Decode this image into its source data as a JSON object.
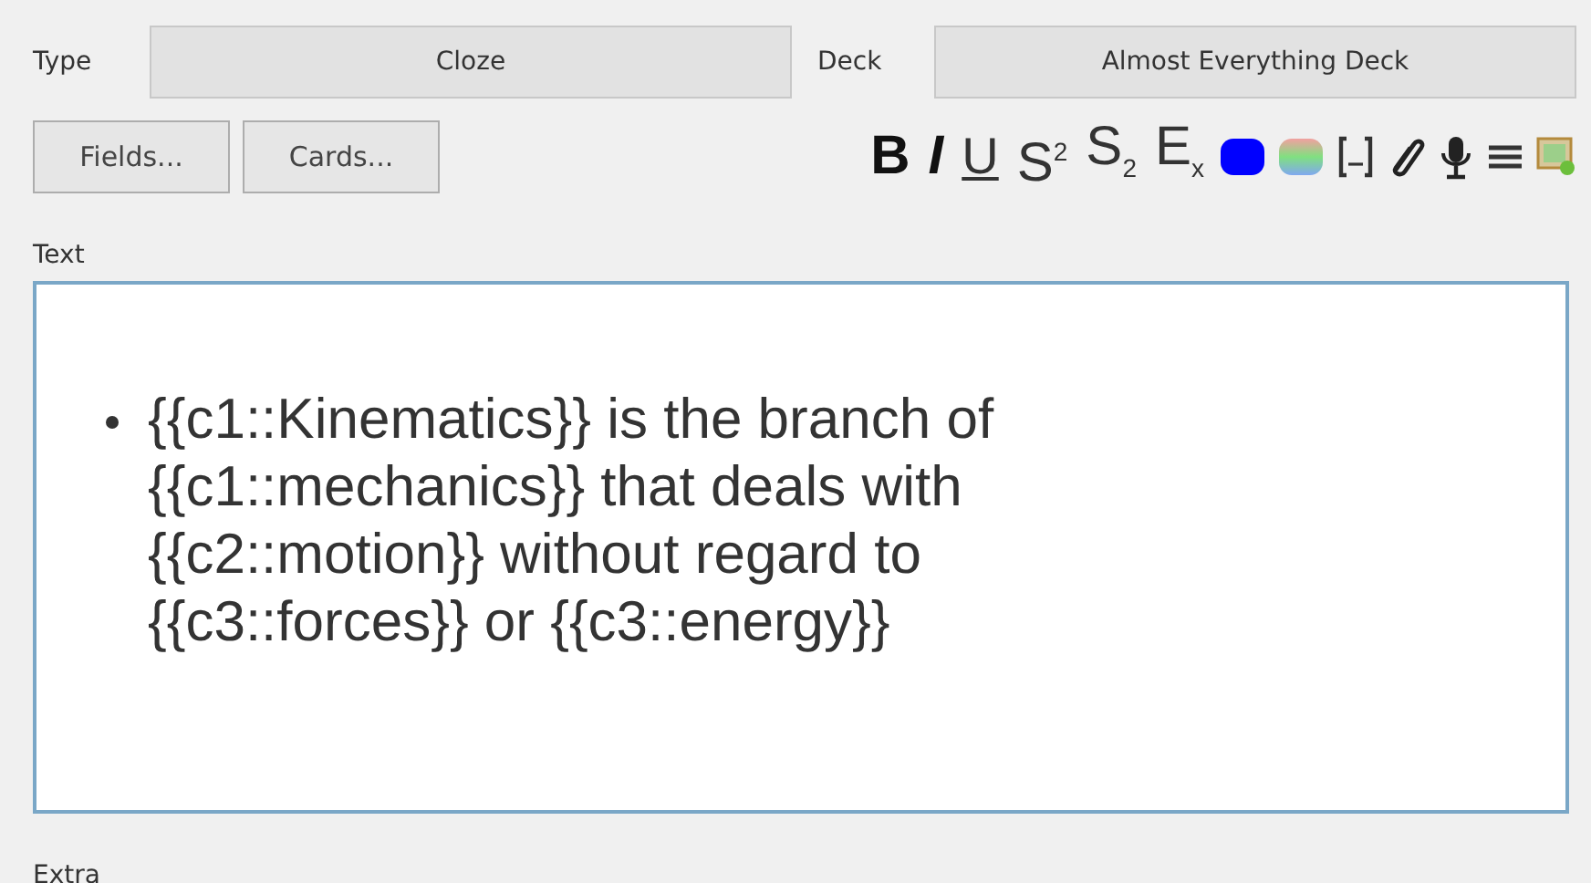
{
  "note_type": {
    "label": "Type",
    "value": "Cloze"
  },
  "deck": {
    "label": "Deck",
    "value": "Almost Everything Deck"
  },
  "buttons": [
    "Fields...",
    "Cards..."
  ],
  "toolbar": [
    {
      "kind": "bold",
      "label": "B"
    },
    {
      "kind": "italic",
      "label": "I"
    },
    {
      "kind": "underline",
      "label": "U"
    },
    {
      "kind": "super",
      "label": "S$^{2}$"
    },
    {
      "kind": "sub",
      "label": "S$_{2}$"
    },
    {
      "kind": "clear",
      "label": "E$_{x}$"
    },
    {
      "kind": "color",
      "color": "#0000ff"
    },
    {
      "kind": "palette"
    },
    {
      "kind": "cloze"
    },
    {
      "kind": "attach"
    },
    {
      "kind": "record"
    },
    {
      "kind": "more"
    },
    {
      "kind": "image"
    }
  ],
  "fields": [
    {
      "label": "Text",
      "bullets": [
        "{{c1::Kinematics}} is the branch of {{c1::mechanics}} that deals with {{c2::motion}} without regard to {{c3::forces}} or {{c3::energy}}"
      ]
    },
    {
      "label": "Extra"
    }
  ]
}
